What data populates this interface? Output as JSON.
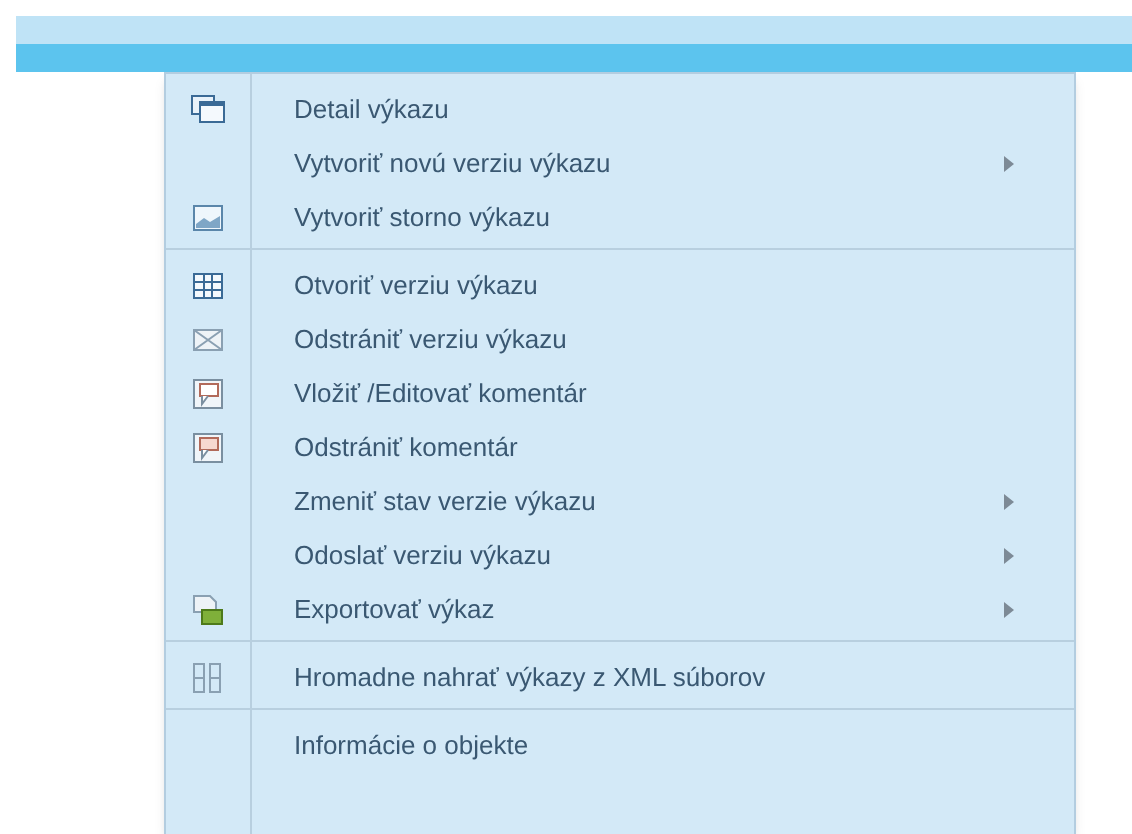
{
  "menu": {
    "items": [
      {
        "label": "Detail výkazu",
        "submenu": false,
        "separator_before": false
      },
      {
        "label": "Vytvoriť novú verziu výkazu",
        "submenu": true,
        "separator_before": false
      },
      {
        "label": "Vytvoriť storno výkazu",
        "submenu": false,
        "separator_before": false
      },
      {
        "label": "Otvoriť verziu výkazu",
        "submenu": false,
        "separator_before": true
      },
      {
        "label": "Odstrániť verziu výkazu",
        "submenu": false,
        "separator_before": false
      },
      {
        "label": "Vložiť /Editovať komentár",
        "submenu": false,
        "separator_before": false
      },
      {
        "label": "Odstrániť komentár",
        "submenu": false,
        "separator_before": false
      },
      {
        "label": "Zmeniť stav verzie výkazu",
        "submenu": true,
        "separator_before": false
      },
      {
        "label": "Odoslať verziu výkazu",
        "submenu": true,
        "separator_before": false
      },
      {
        "label": "Exportovať výkaz",
        "submenu": true,
        "separator_before": false
      },
      {
        "label": "Hromadne nahrať výkazy z XML súborov",
        "submenu": false,
        "separator_before": true
      },
      {
        "label": "Informácie o objekte",
        "submenu": false,
        "separator_before": true
      }
    ]
  }
}
